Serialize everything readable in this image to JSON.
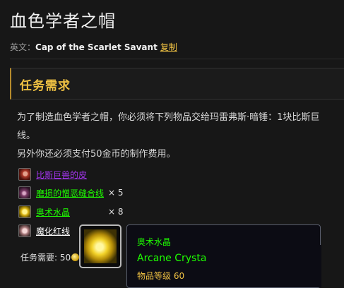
{
  "page": {
    "title": "血色学者之帽",
    "english_prefix": "英文：",
    "english_name": "Cap of the Scarlet Savant",
    "copy_label": "复制"
  },
  "quest": {
    "section_title": "任务需求",
    "description_line1": "为了制造血色学者之帽，你必须将下列物品交给玛雷弗斯·暗锤：1块比斯巨",
    "description_line2": "线。",
    "fee_text": "另外你还必须支付50金币的制作费用。",
    "items": [
      {
        "name": "比斯巨兽的皮",
        "quantity": "",
        "icon": "beast-hide-icon",
        "quality_color": "#a335ee"
      },
      {
        "name": "磨损的憎恶缝合线",
        "quantity": "× 5",
        "icon": "stitching-thread-icon",
        "quality_color": "#1eff00"
      },
      {
        "name": "奥术水晶",
        "quantity": "× 8",
        "icon": "arcane-crystal-icon",
        "quality_color": "#1eff00"
      },
      {
        "name": "魔化红线",
        "quantity": "",
        "icon": "red-thread-icon",
        "quality_color": "#ffffff"
      }
    ],
    "cost_label": "任务需要: 50",
    "cost_icon": "gold-coin-icon"
  },
  "tooltip": {
    "name_cn": "奥术水晶",
    "name_en": "Arcane Crysta",
    "item_level": "物品等级 60",
    "name_color": "#1eff00",
    "icon": "arcane-crystal-icon"
  }
}
